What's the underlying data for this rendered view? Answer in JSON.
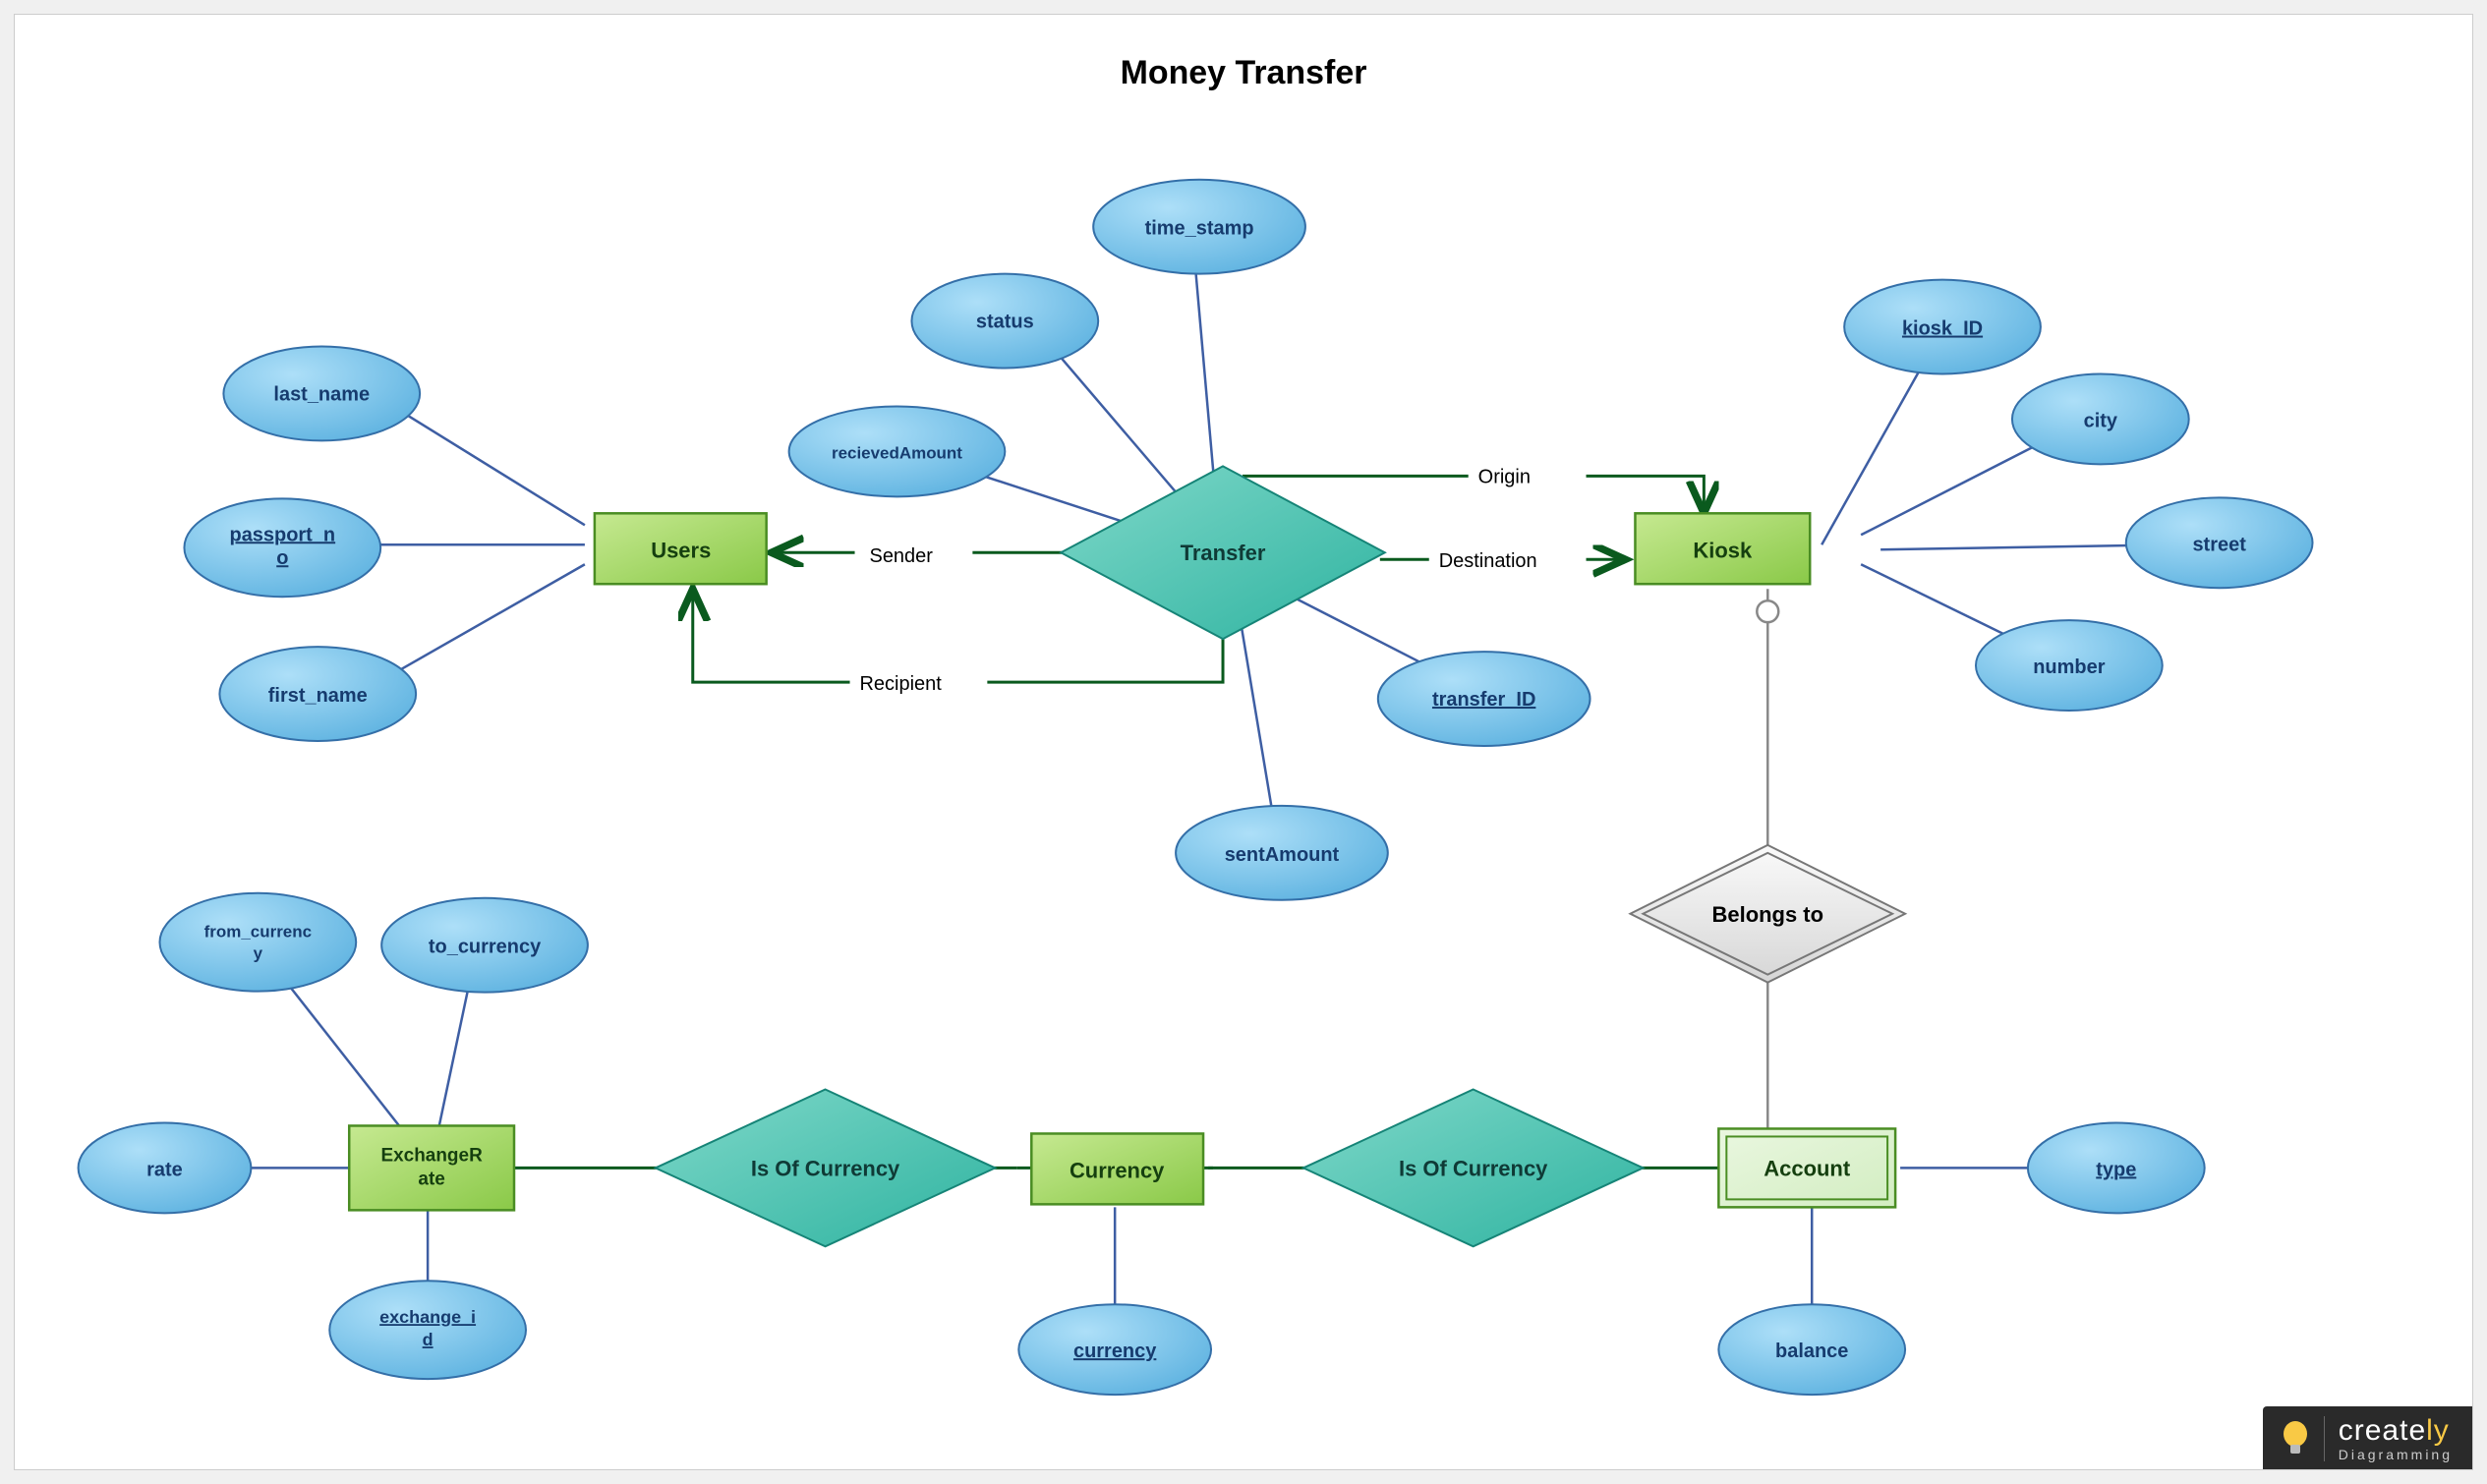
{
  "title": "Money Transfer",
  "entities": {
    "users": "Users",
    "kiosk": "Kiosk",
    "exchangeRate_l1": "ExchangeR",
    "exchangeRate_l2": "ate",
    "currency": "Currency",
    "account": "Account"
  },
  "relationships": {
    "transfer": "Transfer",
    "belongsTo": "Belongs to",
    "isOfCurrency1": "Is Of Currency",
    "isOfCurrency2": "Is Of Currency"
  },
  "attributes": {
    "last_name": "last_name",
    "passport_no_l1": "passport_n",
    "passport_no_l2": "o",
    "first_name": "first_name",
    "recievedAmount": "recievedAmount",
    "status": "status",
    "time_stamp": "time_stamp",
    "transfer_ID": "transfer_ID",
    "sentAmount": "sentAmount",
    "kiosk_ID": "kiosk_ID",
    "city": "city",
    "street": "street",
    "number": "number",
    "from_currency_l1": "from_currenc",
    "from_currency_l2": "y",
    "to_currency": "to_currency",
    "rate": "rate",
    "exchange_id_l1": "exchange_i",
    "exchange_id_l2": "d",
    "currency_attr": "currency",
    "balance": "balance",
    "type": "type"
  },
  "edgeLabels": {
    "origin": "Origin",
    "destination": "Destination",
    "sender": "Sender",
    "recipient": "Recipient"
  },
  "branding": {
    "name_l1": "create",
    "name_l2": "ly",
    "tagline": "Diagramming"
  }
}
